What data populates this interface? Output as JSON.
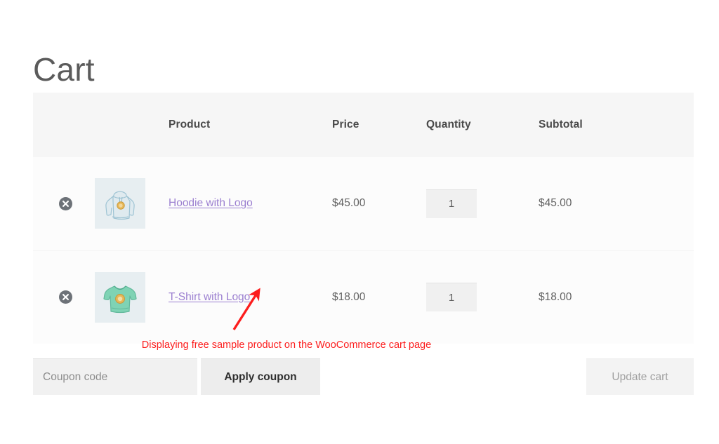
{
  "page": {
    "title": "Cart"
  },
  "table": {
    "headers": {
      "remove": "",
      "thumbnail": "",
      "product": "Product",
      "price": "Price",
      "quantity": "Quantity",
      "subtotal": "Subtotal"
    },
    "rows": [
      {
        "remove_label": "Remove this item",
        "thumbnail_alt": "Hoodie with Logo",
        "thumbnail_kind": "hoodie",
        "name": "Hoodie with Logo",
        "price": "$45.00",
        "quantity": "1",
        "subtotal": "$45.00"
      },
      {
        "remove_label": "Remove this item",
        "thumbnail_alt": "T-Shirt with Logo",
        "thumbnail_kind": "tshirt",
        "name": "T-Shirt with Logo",
        "price": "$18.00",
        "quantity": "1",
        "subtotal": "$18.00"
      }
    ]
  },
  "actions": {
    "coupon_placeholder": "Coupon code",
    "coupon_value": "",
    "apply_coupon_label": "Apply coupon",
    "update_cart_label": "Update cart"
  },
  "annotation": {
    "text": "Displaying free sample product on the WooCommerce cart page",
    "color": "#fc1d1d",
    "arrow": "arrow-up-right-icon"
  },
  "colors": {
    "link": "#9b7fd0",
    "header_row_bg": "#f6f6f6",
    "body_row_bg": "#fcfcfc",
    "remove_circle": "#6d7278",
    "annotation": "#fc1d1d"
  }
}
